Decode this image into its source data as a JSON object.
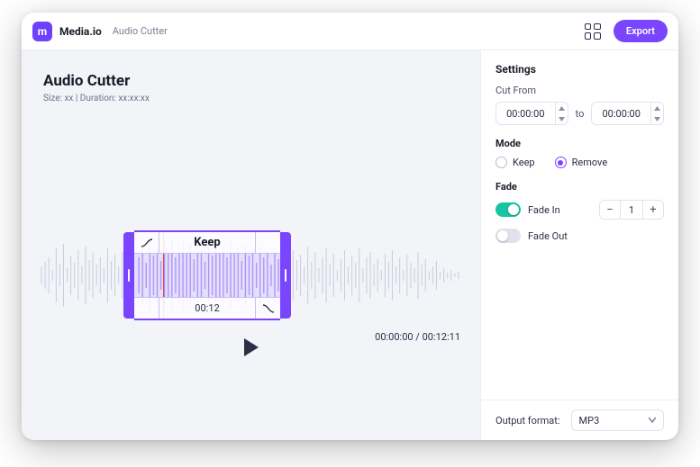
{
  "colors": {
    "accent": "#7a45ff",
    "toggle_on": "#17c5a3"
  },
  "header": {
    "logo_glyph": "m",
    "brand": "Media.io",
    "breadcrumb": "Audio Cutter",
    "export_label": "Export"
  },
  "main": {
    "title": "Audio Cutter",
    "meta": "Size: xx | Duration: xx:xx:xx",
    "selection_label": "Keep",
    "selection_time": "00:12",
    "time_current": "00:00:00",
    "time_total": "00:12:11"
  },
  "sidebar": {
    "settings_title": "Settings",
    "cut_from_label": "Cut From",
    "cut_from_start": "00:00:00",
    "cut_from_to_label": "to",
    "cut_from_end": "00:00:00",
    "mode_label": "Mode",
    "mode_keep": "Keep",
    "mode_remove": "Remove",
    "mode_selected": "remove",
    "fade_label": "Fade",
    "fade_in_label": "Fade In",
    "fade_in_on": true,
    "fade_in_value": "1",
    "fade_out_label": "Fade Out",
    "fade_out_on": false,
    "output_format_label": "Output format:",
    "output_format_value": "MP3"
  }
}
